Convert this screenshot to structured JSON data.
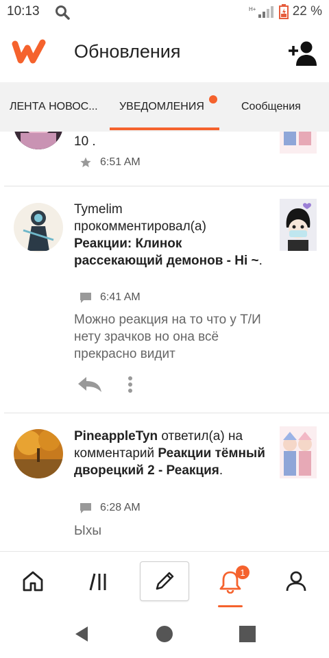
{
  "status_bar": {
    "time": "10:13",
    "battery": "22 %"
  },
  "header": {
    "title": "Обновления"
  },
  "tabs": [
    {
      "label": "ЛЕНТА НОВОС..."
    },
    {
      "label": "УВЕДОМЛЕНИЯ"
    },
    {
      "label": "Сообщения"
    }
  ],
  "notifications": [
    {
      "text_tail": "10 .",
      "time": "6:51 AM"
    },
    {
      "user": "Tymelim",
      "action": "прокомментировал(а)",
      "story": "Реакции: Клинок рассекающий демонов - Hi ~",
      "time": "6:41 AM",
      "comment": "Можно реакция на то что у Т/И нету зрачков но она всё прекрасно видит"
    },
    {
      "user": "PineappleTyn",
      "action": "ответил(а) на комментарий",
      "story": "Реакции тёмный дворецкий 2 - Реакция",
      "time": "6:28 AM",
      "comment": "Ыхы"
    }
  ],
  "bottom_nav": {
    "badge": "1"
  },
  "colors": {
    "accent": "#f5622d",
    "tab_bg": "#f2f2f2"
  }
}
